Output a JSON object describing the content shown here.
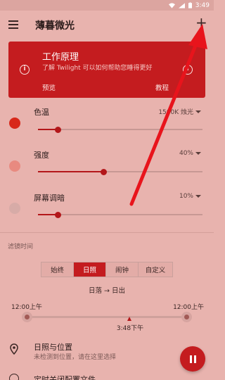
{
  "status_bar": {
    "time": "3:49"
  },
  "app_bar": {
    "title": "薄暮微光",
    "add_label": "+"
  },
  "card": {
    "title": "工作原理",
    "subtitle": "了解 Twilight 可以如何帮助您睡得更好",
    "preview_label": "预览",
    "tutorial_label": "教程",
    "info_glyph": "i"
  },
  "settings": [
    {
      "label": "色温",
      "value": "1500K 烛光",
      "slider": 0.12,
      "dot_color": "#d8281a"
    },
    {
      "label": "强度",
      "value": "40%",
      "slider": 0.4,
      "dot_color": "#e88a80"
    },
    {
      "label": "屏幕调暗",
      "value": "10%",
      "slider": 0.12,
      "dot_color": "#d7aba7"
    }
  ],
  "filter_section": {
    "heading": "滤镜时间",
    "tabs": [
      {
        "label": "始终",
        "active": false
      },
      {
        "label": "日照",
        "active": true
      },
      {
        "label": "闹钟",
        "active": false
      },
      {
        "label": "自定义",
        "active": false
      }
    ],
    "range_text": "日落 → 日出",
    "start_time": "12:00上午",
    "end_time": "12:00上午",
    "now_time": "3:48下午",
    "now_fraction": 0.64
  },
  "location": {
    "title": "日照与位置",
    "subtitle": "未检测到位置，请在这里选择"
  },
  "alarm": {
    "title": "定时关闭配置文件"
  },
  "colors": {
    "accent": "#c41c1f",
    "background": "#e8b3ae",
    "annotation": "#e8141c"
  }
}
